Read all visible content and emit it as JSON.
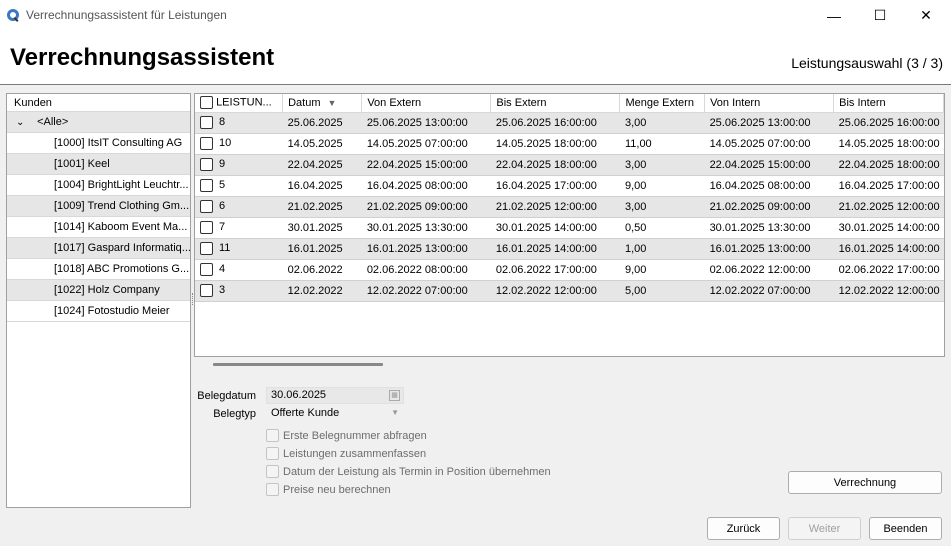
{
  "window": {
    "title": "Verrechnungsassistent für Leistungen",
    "minimize": "—",
    "maximize": "☐",
    "close": "✕"
  },
  "header": {
    "title": "Verrechnungsassistent",
    "step": "Leistungsauswahl (3 / 3)"
  },
  "customers": {
    "header": "Kunden",
    "root": "<Alle>",
    "items": [
      "[1000] ItsIT Consulting AG",
      "[1001] Keel",
      "[1004] BrightLight Leuchtr...",
      "[1009] Trend Clothing Gm...",
      "[1014] Kaboom Event Ma...",
      "[1017] Gaspard Informatiq...",
      "[1018] ABC Promotions G...",
      "[1022] Holz Company",
      "[1024] Fotostudio Meier"
    ]
  },
  "grid": {
    "columns": [
      "LEISTUN...",
      "Datum",
      "Von Extern",
      "Bis Extern",
      "Menge Extern",
      "Von Intern",
      "Bis Intern"
    ],
    "sort_indicator": "▼",
    "rows": [
      [
        "8",
        "25.06.2025",
        "25.06.2025 13:00:00",
        "25.06.2025 16:00:00",
        "3,00",
        "25.06.2025 13:00:00",
        "25.06.2025 16:00:00"
      ],
      [
        "10",
        "14.05.2025",
        "14.05.2025 07:00:00",
        "14.05.2025 18:00:00",
        "11,00",
        "14.05.2025 07:00:00",
        "14.05.2025 18:00:00"
      ],
      [
        "9",
        "22.04.2025",
        "22.04.2025 15:00:00",
        "22.04.2025 18:00:00",
        "3,00",
        "22.04.2025 15:00:00",
        "22.04.2025 18:00:00"
      ],
      [
        "5",
        "16.04.2025",
        "16.04.2025 08:00:00",
        "16.04.2025 17:00:00",
        "9,00",
        "16.04.2025 08:00:00",
        "16.04.2025 17:00:00"
      ],
      [
        "6",
        "21.02.2025",
        "21.02.2025 09:00:00",
        "21.02.2025 12:00:00",
        "3,00",
        "21.02.2025 09:00:00",
        "21.02.2025 12:00:00"
      ],
      [
        "7",
        "30.01.2025",
        "30.01.2025 13:30:00",
        "30.01.2025 14:00:00",
        "0,50",
        "30.01.2025 13:30:00",
        "30.01.2025 14:00:00"
      ],
      [
        "11",
        "16.01.2025",
        "16.01.2025 13:00:00",
        "16.01.2025 14:00:00",
        "1,00",
        "16.01.2025 13:00:00",
        "16.01.2025 14:00:00"
      ],
      [
        "4",
        "02.06.2022",
        "02.06.2022 08:00:00",
        "02.06.2022 17:00:00",
        "9,00",
        "02.06.2022 12:00:00",
        "02.06.2022 17:00:00"
      ],
      [
        "3",
        "12.02.2022",
        "12.02.2022 07:00:00",
        "12.02.2022 12:00:00",
        "5,00",
        "12.02.2022 07:00:00",
        "12.02.2022 12:00:00"
      ]
    ]
  },
  "form": {
    "belegdatum_label": "Belegdatum",
    "belegdatum_value": "30.06.2025",
    "belegtyp_label": "Belegtyp",
    "belegtyp_value": "Offerte Kunde",
    "options": [
      "Erste Belegnummer abfragen",
      "Leistungen zusammenfassen",
      "Datum der Leistung als Termin in Position übernehmen",
      "Preise neu berechnen"
    ]
  },
  "buttons": {
    "verrechnung": "Verrechnung",
    "zurueck": "Zurück",
    "weiter": "Weiter",
    "beenden": "Beenden"
  }
}
